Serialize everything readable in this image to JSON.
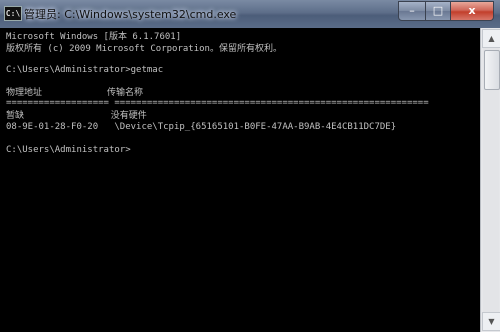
{
  "window": {
    "icon_text": "C:\\",
    "title": "管理员: C:\\Windows\\system32\\cmd.exe",
    "buttons": {
      "minimize": "–",
      "maximize": "□",
      "close": "x"
    }
  },
  "console": {
    "lines": [
      "Microsoft Windows [版本 6.1.7601]",
      "版权所有 (c) 2009 Microsoft Corporation。保留所有权利。",
      "",
      "C:\\Users\\Administrator>getmac",
      "",
      "物理地址            传输名称",
      "=================== ==========================================================",
      "暂缺                没有硬件",
      "08-9E-01-28-F0-20   \\Device\\Tcpip_{65165101-B0FE-47AA-B9AB-4E4CB11DC7DE}",
      "",
      "C:\\Users\\Administrator>"
    ]
  },
  "scrollbar": {
    "up_arrow": "▲",
    "down_arrow": "▼"
  }
}
